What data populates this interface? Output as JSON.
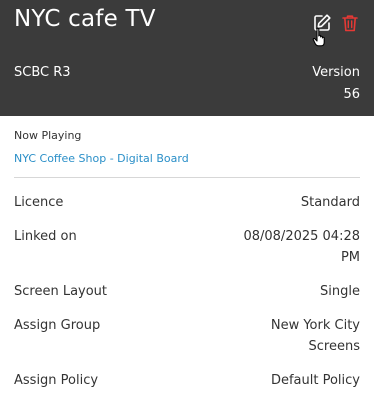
{
  "device": {
    "title": "NYC cafe TV",
    "model": "SCBC R3",
    "version_label": "Version",
    "version_value": "56"
  },
  "actions": {
    "edit_icon": "edit-icon",
    "delete_icon": "trash-icon",
    "delete_color": "#e53935"
  },
  "now_playing": {
    "label": "Now Playing",
    "value": "NYC Coffee Shop - Digital Board",
    "link_color": "#2a8fc8"
  },
  "details": {
    "licence_label": "Licence",
    "licence_value": "Standard",
    "linked_on_label": "Linked on",
    "linked_on_line1": "08/08/2025 04:28",
    "linked_on_line2": "PM",
    "screen_layout_label": "Screen Layout",
    "screen_layout_value": "Single",
    "assign_group_label": "Assign Group",
    "assign_group_line1": "New York City",
    "assign_group_line2": "Screens",
    "assign_policy_label": "Assign Policy",
    "assign_policy_value": "Default Policy"
  },
  "colors": {
    "header_bg": "#3b3b3b",
    "text": "#333333"
  }
}
